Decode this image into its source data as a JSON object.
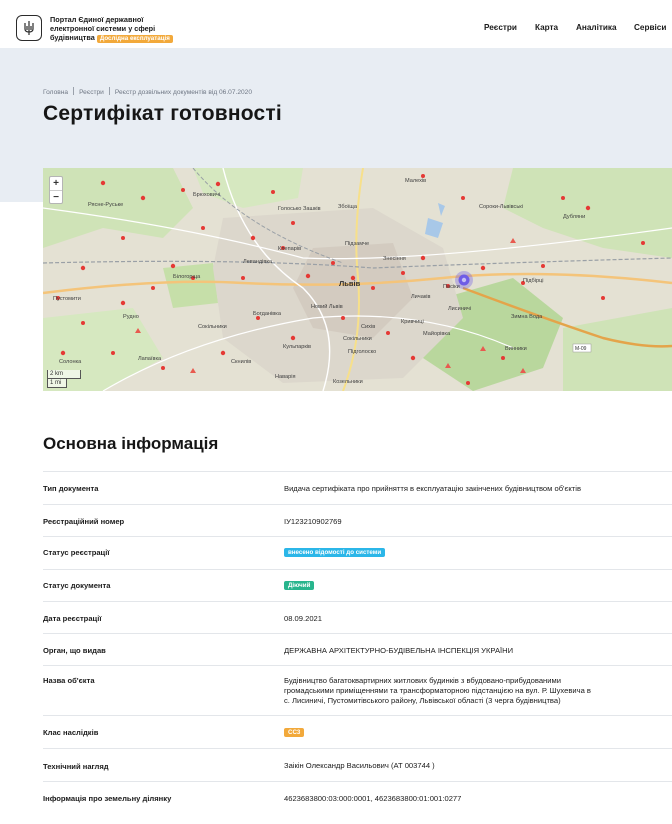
{
  "header": {
    "brand_line1": "Портал Єдиної державної",
    "brand_line2": "електронної системи у сфері",
    "brand_line3": "будівництва",
    "badge": "Дослідна експлуатація",
    "nav": [
      "Реєстри",
      "Карта",
      "Аналітика",
      "Сервіси"
    ]
  },
  "breadcrumb": [
    "Головна",
    "Реєстри",
    "Реєстр дозвільних документів від 06.07.2020"
  ],
  "page_title": "Сертифікат готовності",
  "map": {
    "zoom_in": "+",
    "zoom_out": "−",
    "scale_km": "2 km",
    "scale_mi": "1 mi",
    "places": [
      "Малехів",
      "Зашків",
      "Голосько",
      "Збоїща",
      "Підзамче",
      "Клепарів",
      "Левандівка",
      "Рясне-Руське",
      "Сороки-Львівські",
      "Дубляни",
      "Підбірці",
      "Львів",
      "Білогорща",
      "Богданівка",
      "Сихів",
      "Кульпарків",
      "Личаків",
      "Лисиничі",
      "Винники",
      "Сокільники",
      "Скнилів",
      "Підголоско",
      "Знесіння",
      "Кривчиці",
      "Майорівка",
      "Новий Львів",
      "Пасіки",
      "Рудно",
      "Брюховичі",
      "Козельники",
      "Наварія",
      "Солонка",
      "Зимна Вода",
      "Сокільники",
      "Лапаївка",
      "Пустомити"
    ],
    "road": "M-09"
  },
  "section_title": "Основна інформація",
  "rows": [
    {
      "label": "Тип документа",
      "value": "Видача сертифіката про прийняття в експлуатацію закінчених будівництвом об'єктів"
    },
    {
      "label": "Реєстраційний номер",
      "value": "ІУ123210902769"
    },
    {
      "label": "Статус реєстрації",
      "value": "внесено відомості до системи"
    },
    {
      "label": "Статус документа",
      "value": "Діючий"
    },
    {
      "label": "Дата реєстрації",
      "value": "08.09.2021"
    },
    {
      "label": "Орган, що видав",
      "value": "ДЕРЖАВНА АРХІТЕКТУРНО-БУДІВЕЛЬНА ІНСПЕКЦІЯ УКРАЇНИ"
    },
    {
      "label": "Назва об'єкта",
      "value_lines": [
        "Будівництво багатоквартирних житлових будинків з вбудовано-прибудованими",
        "громадськими приміщеннями та трансформаторною підстанцією на вул. Р. Шухевича в",
        "с. Лисиничі, Пустомитівського району, Львівської області (3 черга будівництва)"
      ]
    },
    {
      "label": "Клас наслідків",
      "value": "СС3"
    },
    {
      "label": "Технічний нагляд",
      "value": "Заікін Олександр Васильович (АТ 003744 )"
    },
    {
      "label": "Інформація про земельну ділянку",
      "value": "4623683800:03:000:0001, 4623683800:01:001:0277"
    }
  ],
  "colors": {
    "hero_bg": "#e8edf3",
    "status_blue": "#2bb6e8",
    "status_green": "#28b58d",
    "accent_orange": "#f2a93b",
    "marker_red": "#e53935",
    "selected_marker": "#6f5ce6"
  }
}
